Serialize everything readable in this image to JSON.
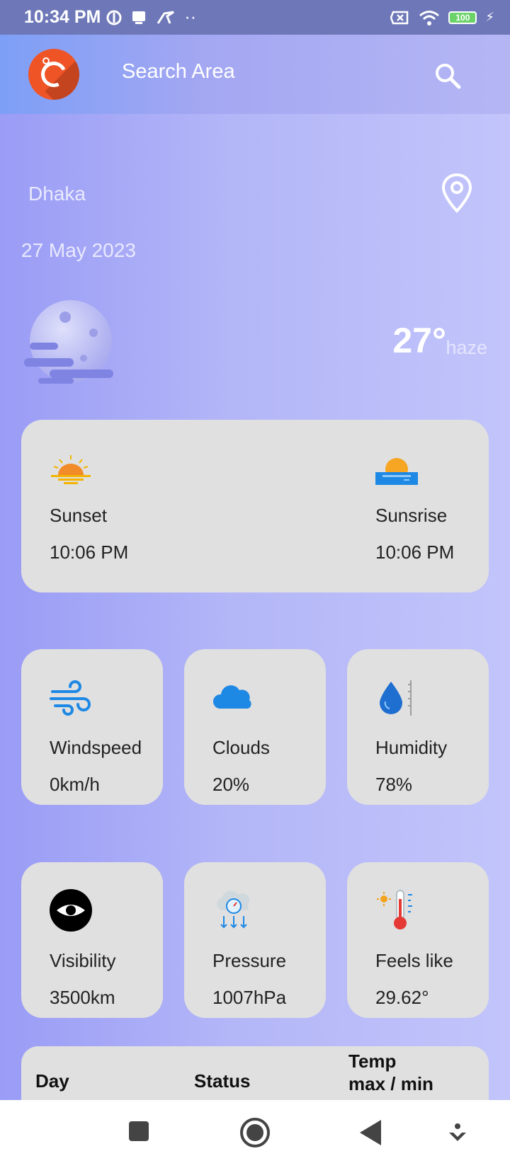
{
  "status_bar": {
    "time": "10:34 PM",
    "battery": "100"
  },
  "app_bar": {
    "search_label": "Search Area"
  },
  "location": {
    "city": "Dhaka",
    "date": "27 May 2023"
  },
  "current": {
    "temperature": "27°",
    "condition": "haze"
  },
  "sun": {
    "sunset_label": "Sunset",
    "sunset_time": "10:06 PM",
    "sunrise_label": "Sunsrise",
    "sunrise_time": "10:06 PM"
  },
  "stats": [
    {
      "label": "Windspeed",
      "value": "0km/h",
      "icon": "wind-icon"
    },
    {
      "label": "Clouds",
      "value": "20%",
      "icon": "cloud-icon"
    },
    {
      "label": "Humidity",
      "value": "78%",
      "icon": "humidity-icon"
    },
    {
      "label": "Visibility",
      "value": "3500km",
      "icon": "eye-icon"
    },
    {
      "label": "Pressure",
      "value": "1007hPa",
      "icon": "pressure-icon"
    },
    {
      "label": "Feels like",
      "value": "29.62°",
      "icon": "thermometer-icon"
    }
  ],
  "forecast_table": {
    "col_day": "Day",
    "col_status": "Status",
    "col_temp_line1": "Temp",
    "col_temp_line2": "max / min"
  },
  "colors": {
    "card_bg": "#e0e0e0",
    "logo": "#ef5426",
    "accent_blue": "#1e88e5"
  }
}
